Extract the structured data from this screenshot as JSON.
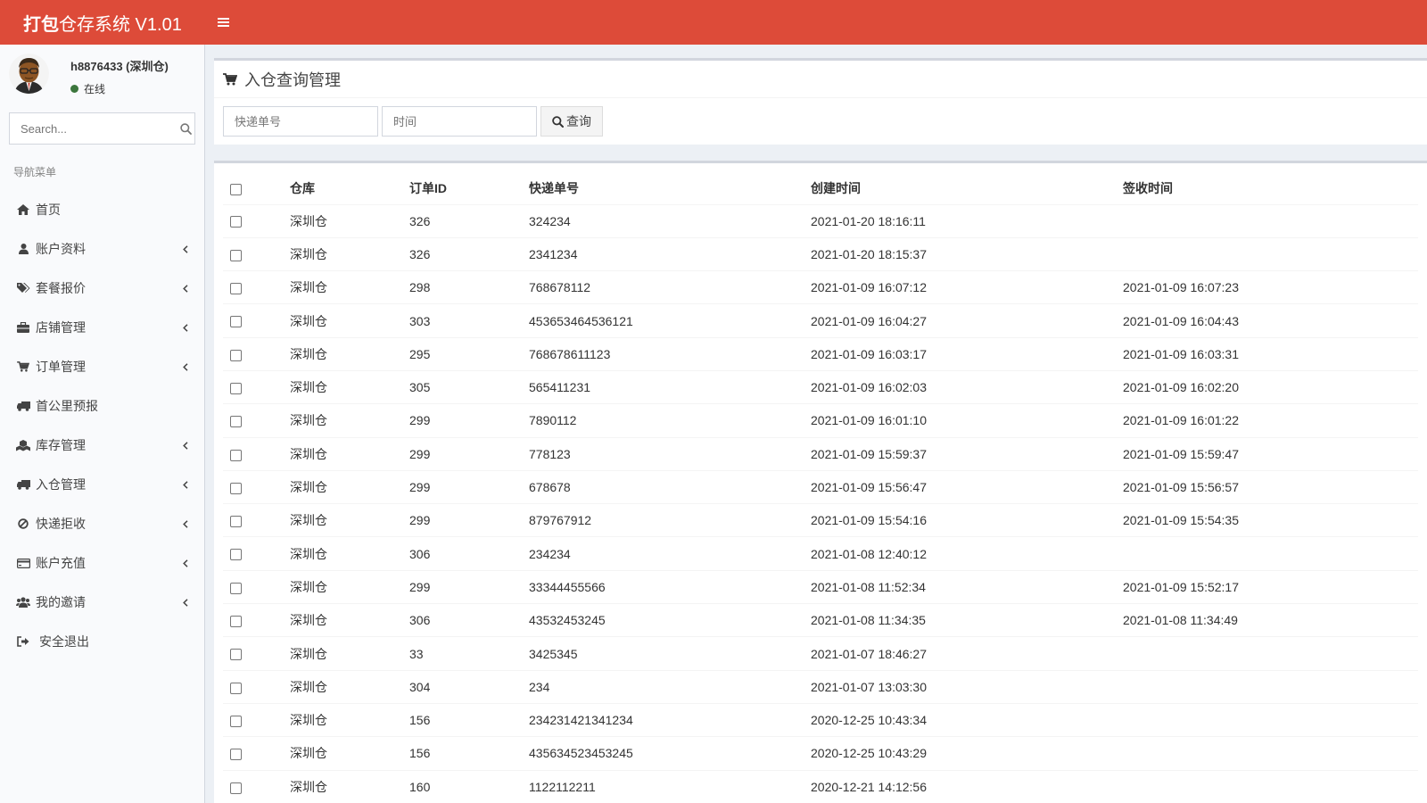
{
  "header": {
    "brand_bold": "打包",
    "brand_rest": "仓存系统 V1.01"
  },
  "user": {
    "name": "h8876433 (深圳仓)",
    "status": "在线"
  },
  "search": {
    "placeholder": "Search..."
  },
  "nav": {
    "header": "导航菜单",
    "items": [
      {
        "label": "首页",
        "icon": "home-icon",
        "chevron": false
      },
      {
        "label": "账户资料",
        "icon": "user-icon",
        "chevron": true
      },
      {
        "label": "套餐报价",
        "icon": "tags-icon",
        "chevron": true
      },
      {
        "label": "店铺管理",
        "icon": "briefcase-icon",
        "chevron": true
      },
      {
        "label": "订单管理",
        "icon": "cart-icon",
        "chevron": true
      },
      {
        "label": "首公里预报",
        "icon": "truck-icon",
        "chevron": false
      },
      {
        "label": "库存管理",
        "icon": "cubes-icon",
        "chevron": true
      },
      {
        "label": "入仓管理",
        "icon": "truck-icon",
        "chevron": true
      },
      {
        "label": "快递拒收",
        "icon": "ban-icon",
        "chevron": true
      },
      {
        "label": "账户充值",
        "icon": "credit-card-icon",
        "chevron": true
      },
      {
        "label": "我的邀请",
        "icon": "users-icon",
        "chevron": true
      },
      {
        "label": "安全退出",
        "icon": "sign-out-icon",
        "chevron": false
      }
    ]
  },
  "page": {
    "title": "入仓查询管理",
    "filter_tracking_placeholder": "快递单号",
    "filter_time_placeholder": "时间",
    "query_label": "查询"
  },
  "table": {
    "columns": [
      "仓库",
      "订单ID",
      "快递单号",
      "创建时间",
      "签收时间"
    ],
    "rows": [
      [
        "深圳仓",
        "326",
        "324234",
        "2021-01-20 18:16:11",
        ""
      ],
      [
        "深圳仓",
        "326",
        "2341234",
        "2021-01-20 18:15:37",
        ""
      ],
      [
        "深圳仓",
        "298",
        "768678112",
        "2021-01-09 16:07:12",
        "2021-01-09 16:07:23"
      ],
      [
        "深圳仓",
        "303",
        "453653464536121",
        "2021-01-09 16:04:27",
        "2021-01-09 16:04:43"
      ],
      [
        "深圳仓",
        "295",
        "768678611123",
        "2021-01-09 16:03:17",
        "2021-01-09 16:03:31"
      ],
      [
        "深圳仓",
        "305",
        "565411231",
        "2021-01-09 16:02:03",
        "2021-01-09 16:02:20"
      ],
      [
        "深圳仓",
        "299",
        "7890112",
        "2021-01-09 16:01:10",
        "2021-01-09 16:01:22"
      ],
      [
        "深圳仓",
        "299",
        "778123",
        "2021-01-09 15:59:37",
        "2021-01-09 15:59:47"
      ],
      [
        "深圳仓",
        "299",
        "678678",
        "2021-01-09 15:56:47",
        "2021-01-09 15:56:57"
      ],
      [
        "深圳仓",
        "299",
        "879767912",
        "2021-01-09 15:54:16",
        "2021-01-09 15:54:35"
      ],
      [
        "深圳仓",
        "306",
        "234234",
        "2021-01-08 12:40:12",
        ""
      ],
      [
        "深圳仓",
        "299",
        "33344455566",
        "2021-01-08 11:52:34",
        "2021-01-09 15:52:17"
      ],
      [
        "深圳仓",
        "306",
        "43532453245",
        "2021-01-08 11:34:35",
        "2021-01-08 11:34:49"
      ],
      [
        "深圳仓",
        "33",
        "3425345",
        "2021-01-07 18:46:27",
        ""
      ],
      [
        "深圳仓",
        "304",
        "234",
        "2021-01-07 13:03:30",
        ""
      ],
      [
        "深圳仓",
        "156",
        "234231421341234",
        "2020-12-25 10:43:34",
        ""
      ],
      [
        "深圳仓",
        "156",
        "435634523453245",
        "2020-12-25 10:43:29",
        ""
      ],
      [
        "深圳仓",
        "160",
        "1122112211",
        "2020-12-21 14:12:56",
        ""
      ]
    ]
  }
}
